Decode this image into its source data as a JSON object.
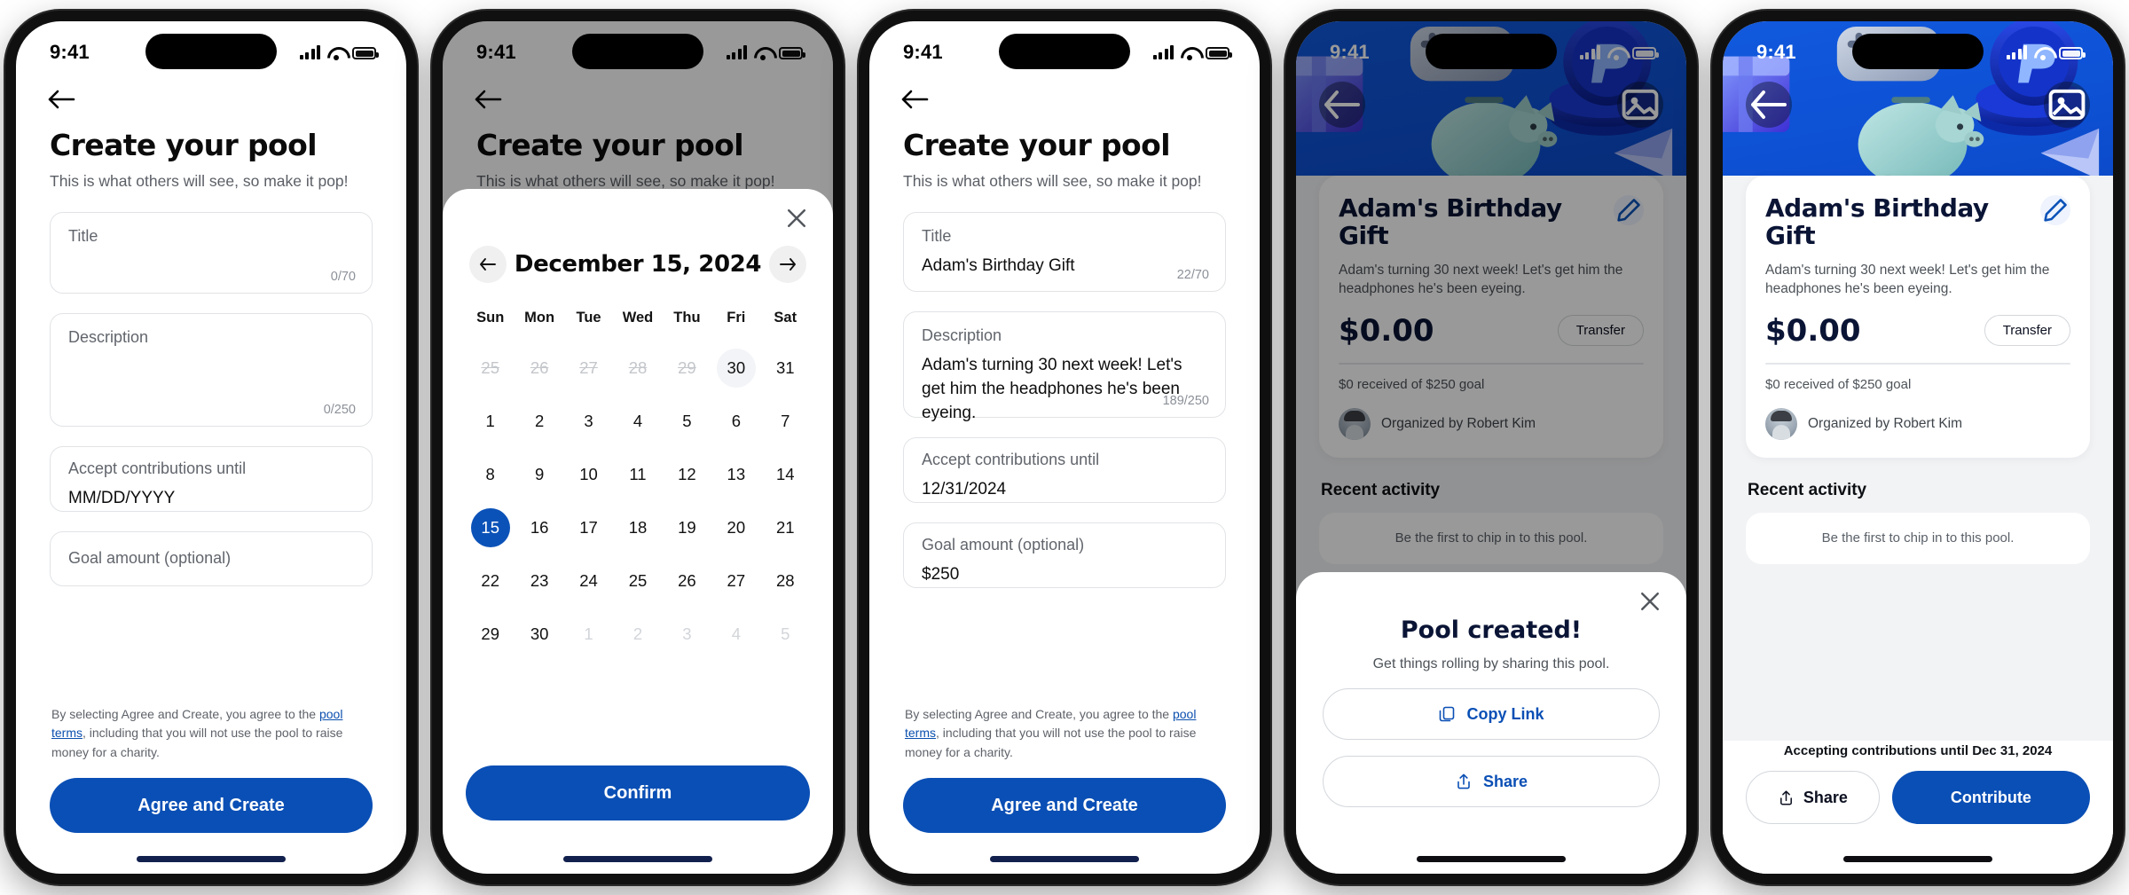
{
  "status_bar": {
    "time": "9:41"
  },
  "screen1": {
    "name": "create-pool-empty",
    "back_icon": "arrow-left-icon",
    "title": "Create your pool",
    "subtitle": "This is what others will see, so make it pop!",
    "fields": [
      {
        "label": "Title",
        "value": "",
        "counter": "0/70"
      },
      {
        "label": "Description",
        "value": "",
        "counter": "0/250"
      },
      {
        "label": "Accept contributions until",
        "value": "MM/DD/YYYY",
        "counter": ""
      },
      {
        "label": "Goal amount (optional)",
        "value": "",
        "counter": ""
      }
    ],
    "legal_pre": "By selecting Agree and Create, you agree to the ",
    "legal_link": "pool terms",
    "legal_post": ", including that you will not use the pool to raise money for a charity.",
    "cta": "Agree and Create"
  },
  "screen2": {
    "name": "create-pool-datepicker",
    "title": "Create your pool",
    "subtitle": "This is what others will see, so make it pop!",
    "close_icon": "close-icon",
    "prev_icon": "arrow-left-icon",
    "next_icon": "arrow-right-icon",
    "calendar": {
      "header": "December 15, 2024",
      "dow": [
        "Sun",
        "Mon",
        "Tue",
        "Wed",
        "Thu",
        "Fri",
        "Sat"
      ],
      "weeks": [
        [
          {
            "d": "25",
            "s": "muted"
          },
          {
            "d": "26",
            "s": "muted"
          },
          {
            "d": "27",
            "s": "muted"
          },
          {
            "d": "28",
            "s": "muted"
          },
          {
            "d": "29",
            "s": "muted"
          },
          {
            "d": "30",
            "s": "today"
          },
          {
            "d": "31",
            "s": ""
          }
        ],
        [
          {
            "d": "1",
            "s": ""
          },
          {
            "d": "2",
            "s": ""
          },
          {
            "d": "3",
            "s": ""
          },
          {
            "d": "4",
            "s": ""
          },
          {
            "d": "5",
            "s": ""
          },
          {
            "d": "6",
            "s": ""
          },
          {
            "d": "7",
            "s": ""
          }
        ],
        [
          {
            "d": "8",
            "s": ""
          },
          {
            "d": "9",
            "s": ""
          },
          {
            "d": "10",
            "s": ""
          },
          {
            "d": "11",
            "s": ""
          },
          {
            "d": "12",
            "s": ""
          },
          {
            "d": "13",
            "s": ""
          },
          {
            "d": "14",
            "s": ""
          }
        ],
        [
          {
            "d": "15",
            "s": "sel"
          },
          {
            "d": "16",
            "s": ""
          },
          {
            "d": "17",
            "s": ""
          },
          {
            "d": "18",
            "s": ""
          },
          {
            "d": "19",
            "s": ""
          },
          {
            "d": "20",
            "s": ""
          },
          {
            "d": "21",
            "s": ""
          }
        ],
        [
          {
            "d": "22",
            "s": ""
          },
          {
            "d": "23",
            "s": ""
          },
          {
            "d": "24",
            "s": ""
          },
          {
            "d": "25",
            "s": ""
          },
          {
            "d": "26",
            "s": ""
          },
          {
            "d": "27",
            "s": ""
          },
          {
            "d": "28",
            "s": ""
          }
        ],
        [
          {
            "d": "29",
            "s": ""
          },
          {
            "d": "30",
            "s": ""
          },
          {
            "d": "1",
            "s": "dim"
          },
          {
            "d": "2",
            "s": "dim"
          },
          {
            "d": "3",
            "s": "dim"
          },
          {
            "d": "4",
            "s": "dim"
          },
          {
            "d": "5",
            "s": "dim"
          }
        ]
      ]
    },
    "confirm": "Confirm"
  },
  "screen3": {
    "name": "create-pool-filled",
    "title": "Create your pool",
    "subtitle": "This is what others will see, so make it pop!",
    "fields": [
      {
        "label": "Title",
        "value": "Adam's Birthday Gift",
        "counter": "22/70"
      },
      {
        "label": "Description",
        "value": "Adam's turning 30 next week! Let's get him the headphones he's been eyeing.",
        "counter": "189/250"
      },
      {
        "label": "Accept contributions until",
        "value": "12/31/2024",
        "counter": ""
      },
      {
        "label": "Goal amount (optional)",
        "value": "$250",
        "counter": ""
      }
    ],
    "legal_pre": "By selecting Agree and Create, you agree to the ",
    "legal_link": "pool terms",
    "legal_post": ", including that you will not use the pool to raise money for a charity.",
    "cta": "Agree and Create"
  },
  "screen4": {
    "name": "pool-detail-created-sheet",
    "back_icon": "arrow-left-icon",
    "image_icon": "image-icon",
    "pool_title": "Adam's Birthday Gift",
    "edit_icon": "pencil-icon",
    "pool_desc": "Adam's turning 30 next week! Let's get him the headphones he's been eyeing.",
    "amount": "$0.00",
    "transfer_label": "Transfer",
    "goal_text": "$0 received of $250 goal",
    "organizer": "Organized by Robert Kim",
    "recent_activity_title": "Recent activity",
    "empty_activity": "Be the first to chip in to this pool.",
    "sheet": {
      "close_icon": "close-icon",
      "title": "Pool created!",
      "subtitle": "Get things rolling by sharing this pool.",
      "copy_icon": "copy-icon",
      "copy_label": "Copy Link",
      "share_icon": "share-icon",
      "share_label": "Share"
    }
  },
  "screen5": {
    "name": "pool-detail",
    "back_icon": "arrow-left-icon",
    "image_icon": "image-icon",
    "pool_title": "Adam's Birthday Gift",
    "edit_icon": "pencil-icon",
    "pool_desc": "Adam's turning 30 next week! Let's get him the headphones he's been eyeing.",
    "amount": "$0.00",
    "transfer_label": "Transfer",
    "goal_text": "$0 received of $250 goal",
    "organizer": "Organized by Robert Kim",
    "recent_activity_title": "Recent activity",
    "empty_activity": "Be the first to chip in to this pool.",
    "accepting_text": "Accepting contributions until Dec 31, 2024",
    "share_icon": "share-icon",
    "share_label": "Share",
    "contribute_label": "Contribute"
  },
  "colors": {
    "brand_blue": "#0a4fb5",
    "hero_blue": "#0e52d6",
    "selected_day": "#0b52b8",
    "text_dark": "#0a1435",
    "muted": "#5b6169"
  }
}
